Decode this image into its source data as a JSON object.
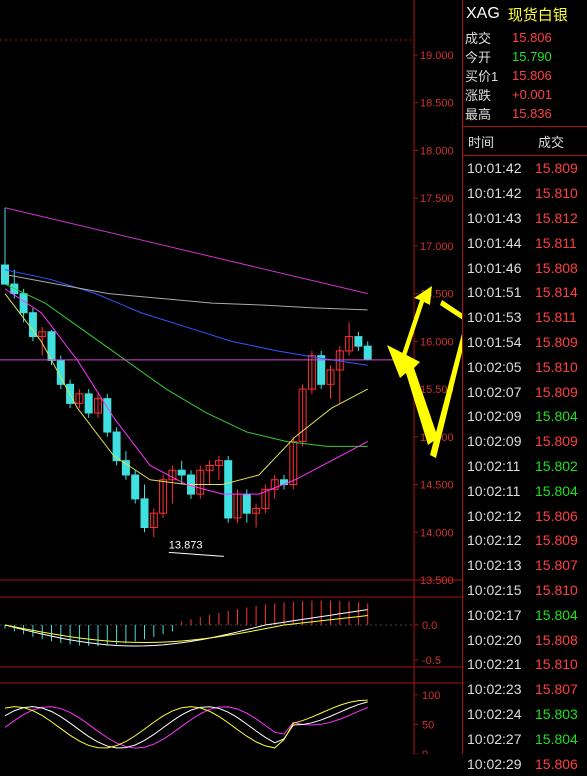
{
  "symbol": "XAG",
  "symbol_name": "现货白银",
  "quote": [
    {
      "label": "成交",
      "value": "15.806",
      "color": "up"
    },
    {
      "label": "今开",
      "value": "15.790",
      "color": "down"
    },
    {
      "label": "买价1",
      "value": "15.806",
      "color": "up"
    },
    {
      "label": "涨跌",
      "value": "+0.001",
      "color": "up"
    },
    {
      "label": "最高",
      "value": "15.836",
      "color": "up"
    }
  ],
  "trades_header": {
    "time": "时间",
    "price": "成交"
  },
  "trades": [
    {
      "time": "10:01:42",
      "price": "15.809",
      "color": "up"
    },
    {
      "time": "10:01:42",
      "price": "15.810",
      "color": "up"
    },
    {
      "time": "10:01:43",
      "price": "15.812",
      "color": "up"
    },
    {
      "time": "10:01:44",
      "price": "15.811",
      "color": "up"
    },
    {
      "time": "10:01:46",
      "price": "15.808",
      "color": "up"
    },
    {
      "time": "10:01:51",
      "price": "15.814",
      "color": "up"
    },
    {
      "time": "10:01:53",
      "price": "15.811",
      "color": "up"
    },
    {
      "time": "10:01:54",
      "price": "15.809",
      "color": "up"
    },
    {
      "time": "10:02:05",
      "price": "15.810",
      "color": "up"
    },
    {
      "time": "10:02:07",
      "price": "15.809",
      "color": "up"
    },
    {
      "time": "10:02:09",
      "price": "15.804",
      "color": "down"
    },
    {
      "time": "10:02:09",
      "price": "15.809",
      "color": "up"
    },
    {
      "time": "10:02:11",
      "price": "15.802",
      "color": "down"
    },
    {
      "time": "10:02:11",
      "price": "15.804",
      "color": "down"
    },
    {
      "time": "10:02:12",
      "price": "15.806",
      "color": "up"
    },
    {
      "time": "10:02:12",
      "price": "15.809",
      "color": "up"
    },
    {
      "time": "10:02:13",
      "price": "15.807",
      "color": "up"
    },
    {
      "time": "10:02:15",
      "price": "15.810",
      "color": "up"
    },
    {
      "time": "10:02:17",
      "price": "15.804",
      "color": "down"
    },
    {
      "time": "10:02:20",
      "price": "15.808",
      "color": "up"
    },
    {
      "time": "10:02:21",
      "price": "15.810",
      "color": "up"
    },
    {
      "time": "10:02:23",
      "price": "15.807",
      "color": "up"
    },
    {
      "time": "10:02:24",
      "price": "15.803",
      "color": "down"
    },
    {
      "time": "10:02:27",
      "price": "15.804",
      "color": "down"
    },
    {
      "time": "10:02:29",
      "price": "15.806",
      "color": "up"
    }
  ],
  "colors": {
    "up": "#ff4040",
    "down": "#20e020",
    "bull_candle": "#ff3030",
    "bear_candle": "#40e0e0",
    "axis": "#b01010",
    "annotation": "#ffff00"
  },
  "chart_data": {
    "type": "candlestick",
    "price_ticks": [
      "19.000",
      "18.500",
      "18.000",
      "17.500",
      "17.000",
      "16.500",
      "16.000",
      "15.500",
      "15.000",
      "14.500",
      "14.000",
      "13.500"
    ],
    "ylim": [
      13.5,
      19.0
    ],
    "low_label": "13.873",
    "last_price": 15.806,
    "candles": [
      [
        16.8,
        17.4,
        16.6,
        16.6
      ],
      [
        16.6,
        16.75,
        16.45,
        16.5
      ],
      [
        16.5,
        16.55,
        16.2,
        16.3
      ],
      [
        16.3,
        16.35,
        16.0,
        16.05
      ],
      [
        16.05,
        16.15,
        15.85,
        16.1
      ],
      [
        16.1,
        16.12,
        15.75,
        15.8
      ],
      [
        15.8,
        15.85,
        15.5,
        15.55
      ],
      [
        15.55,
        15.6,
        15.3,
        15.35
      ],
      [
        15.35,
        15.5,
        15.3,
        15.45
      ],
      [
        15.45,
        15.5,
        15.2,
        15.25
      ],
      [
        15.25,
        15.45,
        15.2,
        15.4
      ],
      [
        15.4,
        15.45,
        15.0,
        15.05
      ],
      [
        15.05,
        15.1,
        14.7,
        14.75
      ],
      [
        14.75,
        14.85,
        14.55,
        14.6
      ],
      [
        14.6,
        14.65,
        14.3,
        14.35
      ],
      [
        14.35,
        14.5,
        14.0,
        14.05
      ],
      [
        14.05,
        14.25,
        13.95,
        14.2
      ],
      [
        14.2,
        14.6,
        14.15,
        14.55
      ],
      [
        14.55,
        14.7,
        14.3,
        14.65
      ],
      [
        14.65,
        14.75,
        14.5,
        14.6
      ],
      [
        14.6,
        14.65,
        14.35,
        14.4
      ],
      [
        14.4,
        14.7,
        14.35,
        14.65
      ],
      [
        14.65,
        14.75,
        14.5,
        14.7
      ],
      [
        14.7,
        14.8,
        14.55,
        14.75
      ],
      [
        14.75,
        14.8,
        14.1,
        14.15
      ],
      [
        14.15,
        14.45,
        14.1,
        14.4
      ],
      [
        14.4,
        14.45,
        14.1,
        14.2
      ],
      [
        14.2,
        14.3,
        14.05,
        14.25
      ],
      [
        14.25,
        14.5,
        14.2,
        14.45
      ],
      [
        14.45,
        14.6,
        14.35,
        14.55
      ],
      [
        14.55,
        14.6,
        14.45,
        14.5
      ],
      [
        14.5,
        15.0,
        14.45,
        14.95
      ],
      [
        14.95,
        15.55,
        14.9,
        15.5
      ],
      [
        15.5,
        15.9,
        15.45,
        15.85
      ],
      [
        15.85,
        15.9,
        15.5,
        15.55
      ],
      [
        15.55,
        15.75,
        15.4,
        15.7
      ],
      [
        15.7,
        15.95,
        15.35,
        15.9
      ],
      [
        15.9,
        16.2,
        15.85,
        16.05
      ],
      [
        16.05,
        16.1,
        15.9,
        15.95
      ],
      [
        15.95,
        16.0,
        15.8,
        15.81
      ]
    ],
    "ma_lines": [
      {
        "color": "#cc33cc",
        "values": [
          17.4,
          16.5
        ]
      },
      {
        "color": "#3355ff",
        "values": [
          16.75,
          16.65,
          16.5,
          16.3,
          16.15,
          16.0,
          15.9,
          15.82,
          15.75
        ]
      },
      {
        "color": "#aaaaaa",
        "values": [
          16.7,
          16.6,
          16.5,
          16.45,
          16.4,
          16.38,
          16.35,
          16.33
        ]
      },
      {
        "color": "#33cc33",
        "values": [
          16.6,
          16.4,
          16.1,
          15.8,
          15.5,
          15.25,
          15.05,
          14.95,
          14.9,
          14.9
        ]
      },
      {
        "color": "#dddd55",
        "values": [
          16.5,
          16.0,
          15.3,
          14.8,
          14.55,
          14.5,
          14.5,
          14.6,
          15.0,
          15.3,
          15.5
        ]
      },
      {
        "color": "#ff33ff",
        "values": [
          16.55,
          16.3,
          15.8,
          15.2,
          14.7,
          14.5,
          14.4,
          14.4,
          14.55,
          14.75,
          14.95
        ]
      }
    ],
    "macd": {
      "ticks": [
        "0.0",
        "-0.5"
      ],
      "range": [
        -0.6,
        0.4
      ]
    },
    "kdj": {
      "ticks": [
        "100",
        "50",
        "0"
      ],
      "range": [
        0,
        120
      ]
    }
  }
}
